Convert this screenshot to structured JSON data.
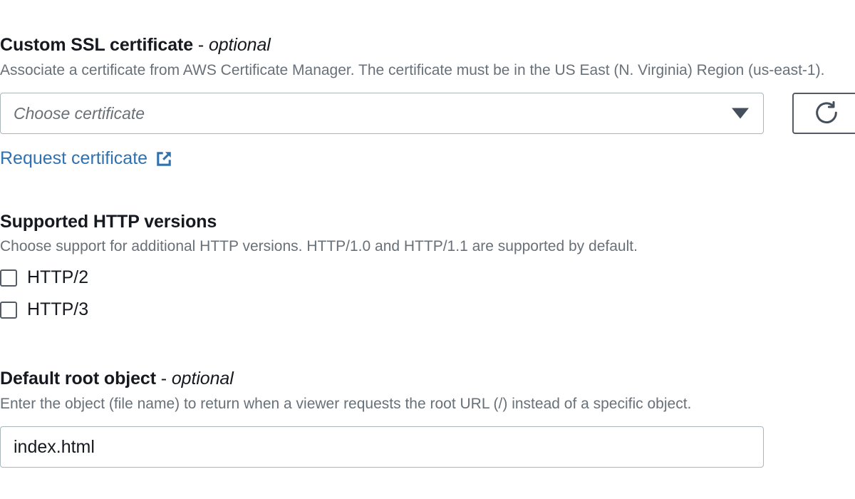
{
  "sections": {
    "ssl": {
      "label_main": "Custom SSL certificate",
      "label_dash": " - ",
      "label_optional": "optional",
      "description": "Associate a certificate from AWS Certificate Manager. The certificate must be in the US East (N. Virginia) Region (us-east-1).",
      "select": {
        "placeholder": "Choose certificate",
        "value": "",
        "arrow_icon": "chevron-down-icon"
      },
      "refresh_button": {
        "icon": "refresh-icon",
        "label": ""
      },
      "link": {
        "text": "Request certificate",
        "icon": "external-link-icon"
      }
    },
    "http_versions": {
      "label_main": "Supported HTTP versions",
      "description": "Choose support for additional HTTP versions. HTTP/1.0 and HTTP/1.1 are supported by default.",
      "options": [
        {
          "label": "HTTP/2",
          "checked": false
        },
        {
          "label": "HTTP/3",
          "checked": false
        }
      ]
    },
    "default_root_object": {
      "label_main": "Default root object",
      "label_dash": " - ",
      "label_optional": "optional",
      "description": "Enter the object (file name) to return when a viewer requests the root URL (/) instead of a specific object.",
      "input": {
        "value": "index.html",
        "placeholder": "index.html"
      }
    }
  },
  "colors": {
    "link": "#3072b0",
    "text_primary": "#16191f",
    "text_secondary": "#687078",
    "border_input": "#aab7b8",
    "border_button": "#545b64",
    "background": "#ffffff"
  }
}
